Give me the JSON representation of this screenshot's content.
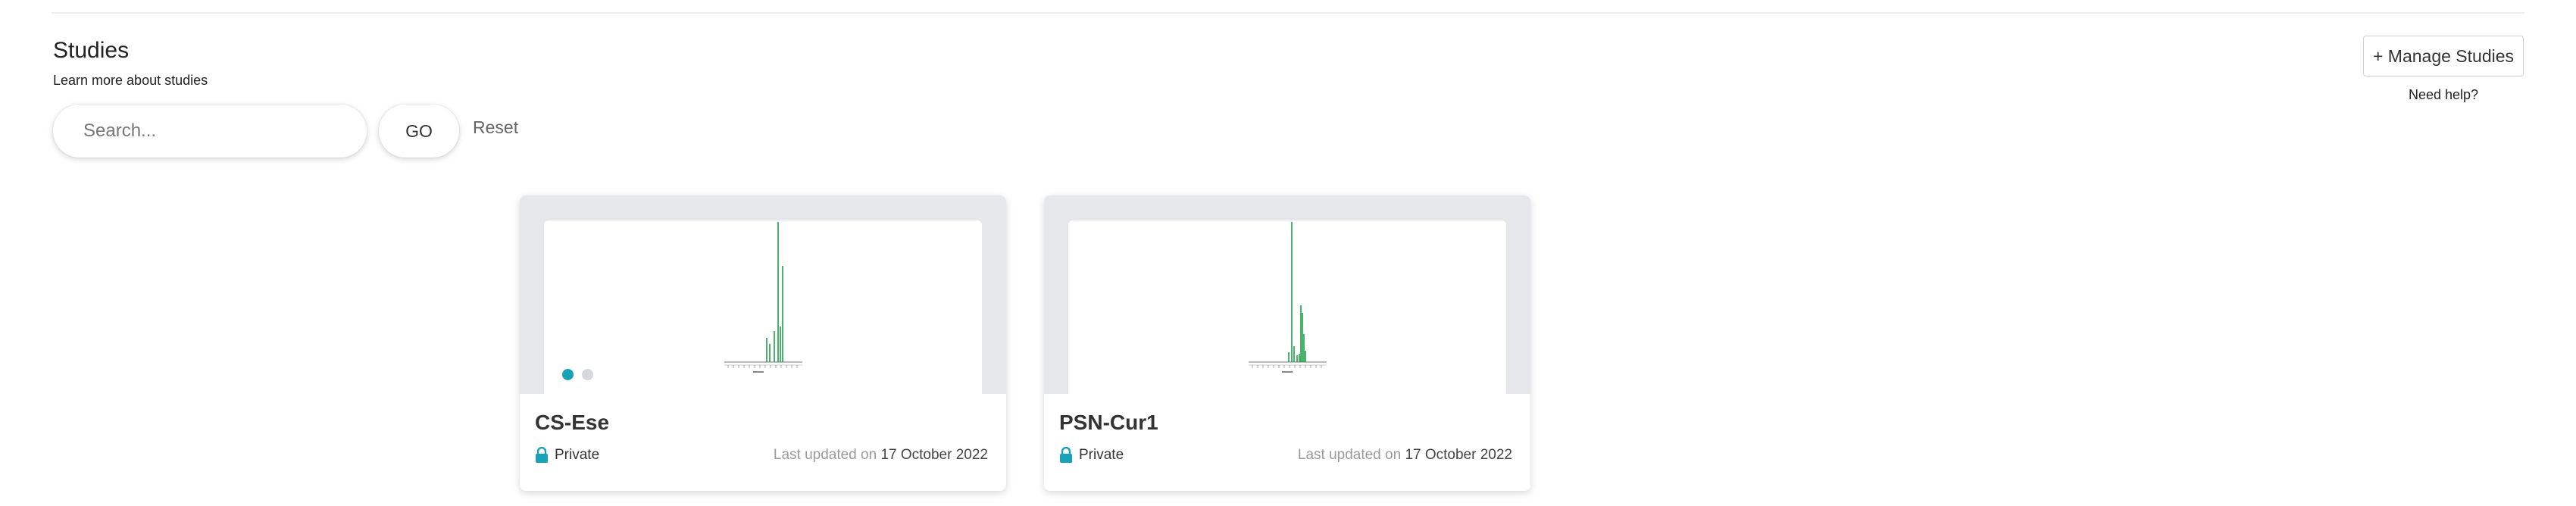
{
  "header": {
    "title": "Studies",
    "subtitle": "Learn more about studies",
    "manage_label": "+ Manage Studies",
    "help_label": "Need help?"
  },
  "search": {
    "placeholder": "Search...",
    "value": "",
    "go_label": "GO",
    "reset_label": "Reset"
  },
  "colors": {
    "accent": "#17a2b8",
    "chart_green": "#1e9e4a",
    "card_media_bg": "#e6e7ea"
  },
  "cards": [
    {
      "title": "CS-Ese",
      "privacy": "Private",
      "privacy_icon": "lock-icon",
      "updated_prefix": "Last updated on",
      "updated_date": "17 October 2022",
      "carousel": {
        "count": 2,
        "active": 0
      }
    },
    {
      "title": "PSN-Cur1",
      "privacy": "Private",
      "privacy_icon": "lock-icon",
      "updated_prefix": "Last updated on",
      "updated_date": "17 October 2022",
      "carousel": {
        "count": 0,
        "active": null
      }
    }
  ]
}
